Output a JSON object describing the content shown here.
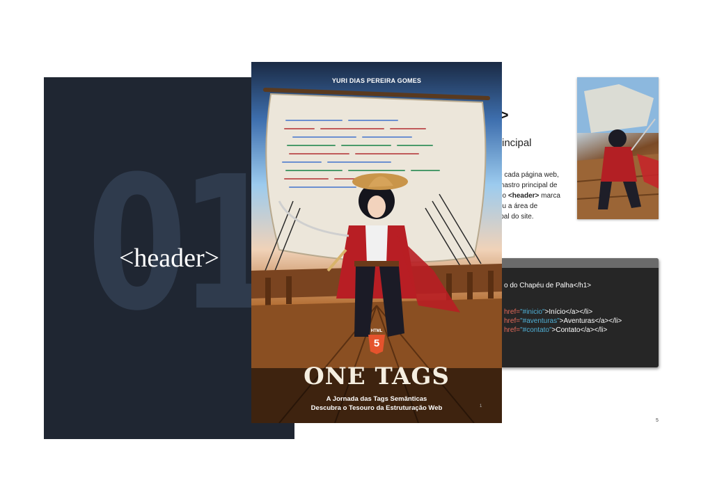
{
  "chapter": {
    "number": "01",
    "tag": "<header>"
  },
  "cover": {
    "author": "YURI DIAS PEREIRA GOMES",
    "html5_label": "HTML",
    "html5_number": "5",
    "title": "ONE TAGS",
    "subtitle_1": "A Jornada das Tags Semânticas",
    "subtitle_2": "Descubra o Tesouro da Estruturação Web",
    "page_number": "1"
  },
  "page": {
    "heading": "'>",
    "subheading": "rincipal",
    "para_line_1": "e cada página web,",
    "para_line_2": "mastro principal de",
    "para_line_3a": ", o ",
    "para_line_3b": "<header>",
    "para_line_3c": " marca",
    "para_line_4": "ou a área de",
    "para_line_5": "ipal do site.",
    "page_number": "5"
  },
  "code": {
    "line_1": "o do Chapéu de Palha</h1>",
    "line_2_attr": "href=",
    "line_2_str": "\"#inicio\"",
    "line_2_rest": ">Início</a></li>",
    "line_3_attr": "href=",
    "line_3_str": "\"#aventuras\"",
    "line_3_rest": ">Aventuras</a></li>",
    "line_4_attr": "href=",
    "line_4_str": "\"#contato\"",
    "line_4_rest": ">Contato</a></li>"
  },
  "colors": {
    "chapter_bg": "#1f2632",
    "chapter_number": "#2f3b4d",
    "code_bg": "#262626",
    "code_attr": "#e36a5a",
    "code_string": "#4fb0d6"
  }
}
